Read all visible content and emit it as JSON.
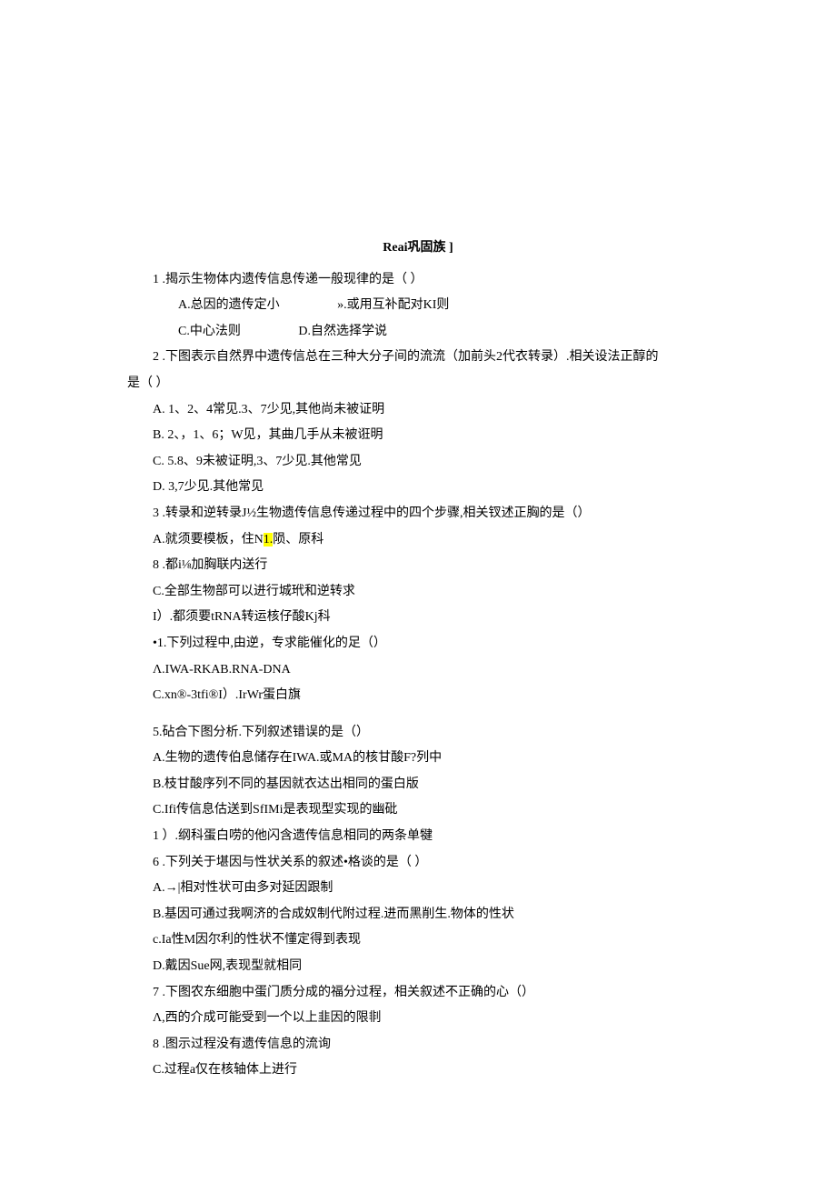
{
  "header": "Reai巩固族 ]",
  "q1": {
    "stem": "1 .揭示生物体内遗传信息传递一般现律的是（ ）",
    "optA": "A.总因的遗传定小",
    "optB": "».或用互补配对KI则",
    "optC": "C.中心法则",
    "optD": "D.自然选择学说"
  },
  "q2": {
    "stem1": "2  .下图表示自然界中遗传信总在三种大分子间的流流（加前头2代衣转录）.相关设法正醇的",
    "stem2": "是（    ）",
    "optA": "A.  1、2、4常见.3、7少见,其他尚未被证明",
    "optB": "B.  2、，1、6；W见，其曲几手从未被诳明",
    "optC": "C.  5.8、9未被证明,3、7少见.其他常见",
    "optD": "D.  3,7少见.其他常见"
  },
  "q3": {
    "stem": "3  .转录和逆转录J½生物遗传信息传递过程中的四个步骤,相关钗述正胸的是（）",
    "optA_pre": "A.就须要模板，住N",
    "optA_hi": "1.",
    "optA_post": "陨、原科",
    "optB": "8  .都i⅛加胸联内送行",
    "optC": "C.全部生物部可以进行城玳和逆转求",
    "optD": "I）.都须要tRNA转运核仔酸Kj科"
  },
  "q4": {
    "stem": "•1.下列过程中,由逆，专求能催化的足（）",
    "optAB": "Λ.IWA-RKAB.RNA-DNA",
    "optCD": "C.xn®-3tfi®I）.IrWr蛋白旗"
  },
  "q5": {
    "stem": "5.砧合下图分析.下列叙述错误的是（）",
    "optA": "A.生物的遗传伯息储存在IWA.或MA的核甘酸F?列中",
    "optB": "B.枝甘酸序列不同的基因就衣达出相同的蛋白版",
    "optC": "C.Ifi传信息估送到SfIMi是表现型实现的幽砒",
    "optD": "1 ）.纲科蛋白唠的他闪含遗传信息相同的两条单犍"
  },
  "q6": {
    "stem": "6  .下列关于堪因与性状关系的叙述•格谈的是（ ）",
    "optA": "A.→|相对性状可由多对延因跟制",
    "optB": "B.基因可通过我啊济的合成奴制代附过程.进而黑削生.物体的性状",
    "optC": "c.Ia性M因尔利的性状不懂定得到表现",
    "optD": "D.戴因Sue网,表现型就相同"
  },
  "q7": {
    "stem": "7  .下图农东细胞中蛋门质分成的福分过程，相关叙述不正确的心（）",
    "optA": "Λ,西的介成可能受到一个以上韭因的限剕",
    "optB": "8  .图示过程没有遗传信息的流询",
    "optC": "C.过程a仅在核轴体上进行"
  }
}
